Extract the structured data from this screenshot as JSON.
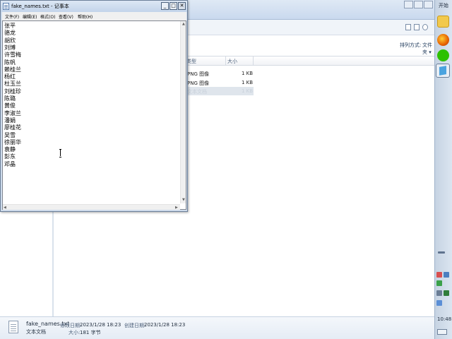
{
  "notepad": {
    "title": "fake_names.txt - 记事本",
    "menu": [
      "文件(F)",
      "编辑(E)",
      "格式(O)",
      "查看(V)",
      "帮助(H)"
    ],
    "lines": [
      "张平",
      "骆龙",
      "胡欣",
      "刘博",
      "许雪梅",
      "陈帆",
      "赖桂兰",
      "杨红",
      "杜玉兰",
      "刘桂珍",
      "陈璐",
      "黄俊",
      "李淑兰",
      "潘娟",
      "廖桂花",
      "吴雪",
      "徐丽华",
      "袁静",
      "彭东",
      "邓晶"
    ],
    "minimize": "_",
    "maximize": "□",
    "close": "✕"
  },
  "explorer": {
    "arrange_label": "排列方式:",
    "arrange_value": "文件夹 ▾",
    "columns": [
      "类型",
      "大小"
    ],
    "rows": [
      {
        "type": "PNG 图像",
        "size": "1 KB"
      },
      {
        "type": "PNG 图像",
        "size": "1 KB"
      },
      {
        "type": "文本文档",
        "size": "1 KB"
      }
    ],
    "status": {
      "filename": "fake_names.txt",
      "filetype": "文本文档",
      "modified_label": "修改日期:",
      "modified": "2023/1/28 18:23",
      "created_label": "创建日期:",
      "created": "2023/1/28 18:23",
      "size_label": "大小:",
      "size": "181 字节"
    }
  },
  "taskbar": {
    "start_label": "开始",
    "clock": "10:48"
  },
  "colors": {
    "accent": "#3c6ea8",
    "firefox": "#e66000",
    "wechat": "#2dc100",
    "folder": "#f2c94c"
  }
}
